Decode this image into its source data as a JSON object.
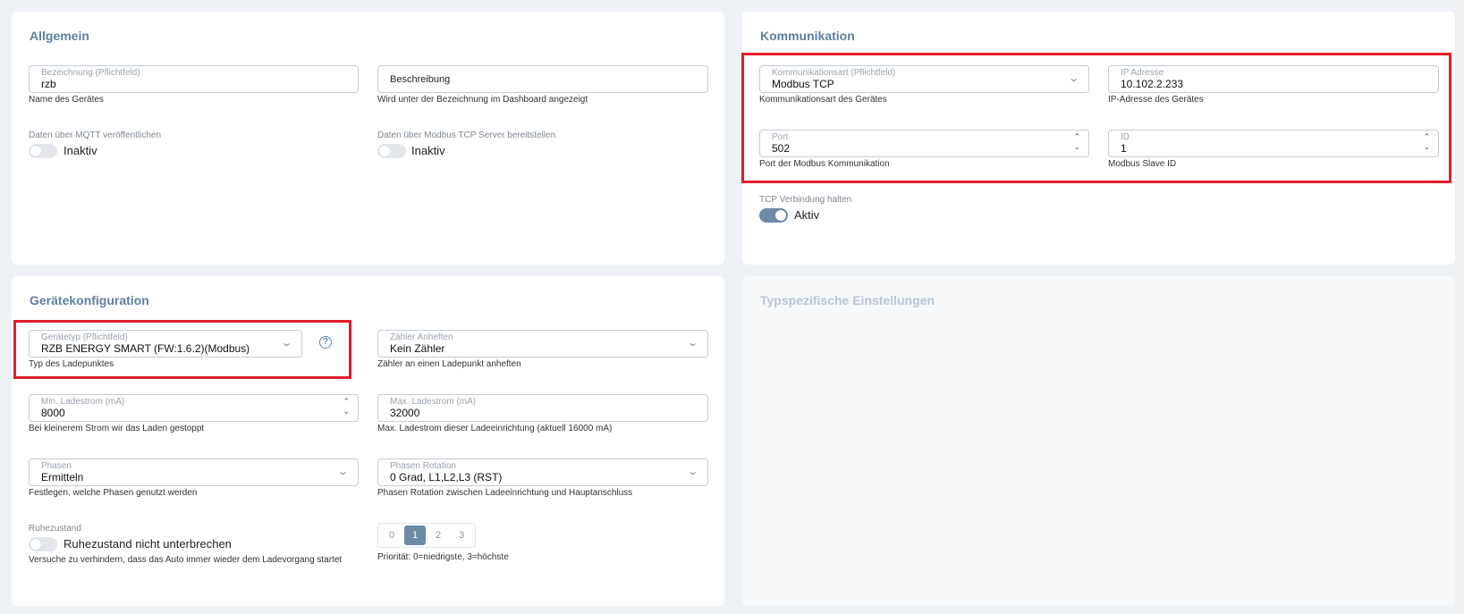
{
  "allgemein": {
    "title": "Allgemein",
    "bezeichnung": {
      "label": "Bezeichnung (Pflichtfeld)",
      "value": "rzb",
      "hint": "Name des Gerätes"
    },
    "beschreibung": {
      "placeholder": "Beschreibung",
      "hint": "Wird unter der Bezeichnung im Dashboard angezeigt"
    },
    "mqtt": {
      "label": "Daten über MQTT veröffentlichen",
      "state": "Inaktiv",
      "on": false
    },
    "modbus_server": {
      "label": "Daten über Modbus TCP Server bereitstellen",
      "state": "Inaktiv",
      "on": false
    }
  },
  "kommunikation": {
    "title": "Kommunikation",
    "art": {
      "label": "Kommunikationsart (Pflichtfeld)",
      "value": "Modbus TCP",
      "hint": "Kommunikationsart des Gerätes"
    },
    "ip": {
      "label": "IP Adresse",
      "value": "10.102.2.233",
      "hint": "IP-Adresse des Gerätes"
    },
    "port": {
      "label": "Port",
      "value": "502",
      "hint": "Port der Modbus Kommunikation"
    },
    "id": {
      "label": "ID",
      "value": "1",
      "hint": "Modbus Slave ID"
    },
    "tcp_halten": {
      "label": "TCP Verbindung halten",
      "state": "Aktiv",
      "on": true
    }
  },
  "geraetekonfiguration": {
    "title": "Gerätekonfiguration",
    "geraetetyp": {
      "label": "Gerätetyp (Pflichtfeld)",
      "value": "RZB ENERGY SMART (FW:1.6.2)(Modbus)",
      "hint": "Typ des Ladepunktes",
      "help": "?"
    },
    "zaehler": {
      "label": "Zähler Anheften",
      "value": "Kein Zähler",
      "hint": "Zähler an einen Ladepunkt anheften"
    },
    "min_ladestrom": {
      "label": "Min. Ladestrom (mA)",
      "value": "8000",
      "hint": "Bei kleinerem Strom wir das Laden gestoppt"
    },
    "max_ladestrom": {
      "label": "Max. Ladestrom (mA)",
      "value": "32000",
      "hint": "Max. Ladestrom dieser Ladeeinrichtung (aktuell 16000 mA)"
    },
    "phasen": {
      "label": "Phasen",
      "value": "Ermitteln",
      "hint": "Festlegen, welche Phasen genutzt werden"
    },
    "phasen_rotation": {
      "label": "Phasen Rotation",
      "value": "0 Grad, L1,L2,L3 (RST)",
      "hint": "Phasen Rotation zwischen Ladeeinrichtung und Hauptanschluss"
    },
    "ruhezustand": {
      "label": "Ruhezustand",
      "state": "Ruhezustand nicht unterbrechen",
      "on": false,
      "hint": "Versuche zu verhindern, dass das Auto immer wieder dem Ladevorgang startet"
    },
    "prioritaet": {
      "options": [
        "0",
        "1",
        "2",
        "3"
      ],
      "selected": "1",
      "hint": "Priorität: 0=niedrigste, 3=höchste"
    }
  },
  "typspezifisch": {
    "title": "Typspezifische Einstellungen"
  },
  "icons": {
    "chevron": "chevron-down-icon",
    "spinner": "spinner-arrows-icon",
    "help": "help-circle-icon"
  },
  "colors": {
    "accent": "#6d8aa6",
    "highlight": "#e01e2b",
    "title": "#5f7f9f"
  }
}
